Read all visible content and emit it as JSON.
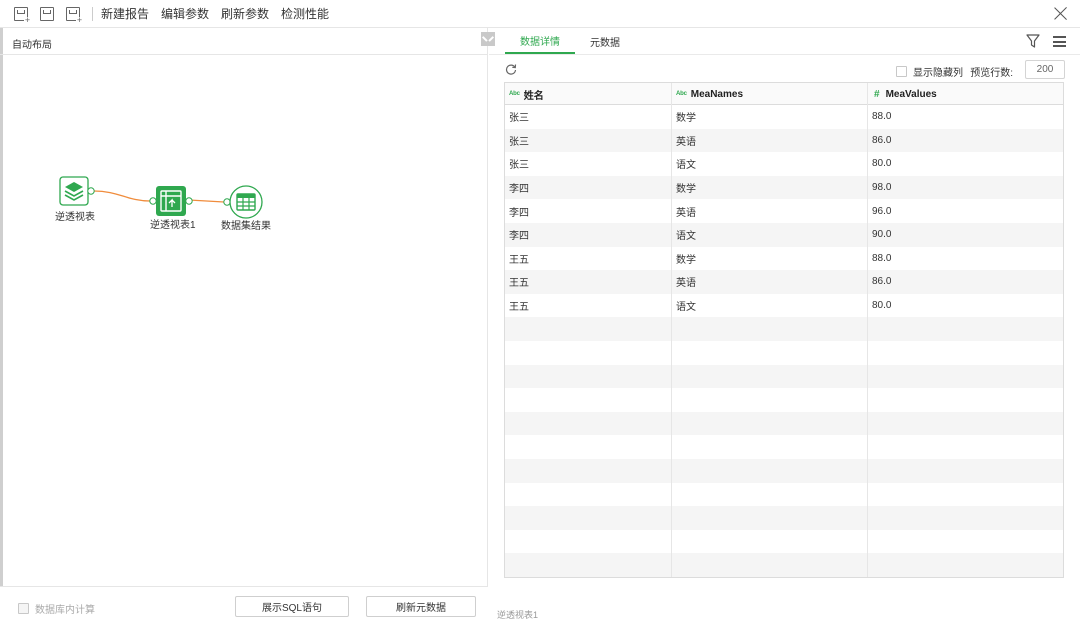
{
  "toolbar": {
    "new_report": "新建报告",
    "edit_params": "编辑参数",
    "refresh_params": "刷新参数",
    "check_performance": "检测性能"
  },
  "left": {
    "auto_layout": "自动布局",
    "nodes": [
      {
        "label": "逆透视表",
        "icon": "layers-icon"
      },
      {
        "label": "逆透视表1",
        "icon": "unpivot-icon"
      },
      {
        "label": "数据集结果",
        "icon": "table-icon"
      }
    ],
    "footer": {
      "db_compute_label": "数据库内计算",
      "show_sql": "展示SQL语句",
      "refresh_meta": "刷新元数据"
    }
  },
  "right": {
    "tabs": [
      {
        "label": "数据详情",
        "active": true
      },
      {
        "label": "元数据",
        "active": false
      }
    ],
    "show_hidden_label": "显示隐藏列",
    "preview_label": "预览行数:",
    "preview_rows": "200",
    "columns": [
      {
        "type": "Abc",
        "label": "姓名"
      },
      {
        "type": "Abc",
        "label": "MeaNames"
      },
      {
        "type": "#",
        "label": "MeaValues"
      }
    ],
    "rows": [
      [
        "张三",
        "数学",
        "88.0"
      ],
      [
        "张三",
        "英语",
        "86.0"
      ],
      [
        "张三",
        "语文",
        "80.0"
      ],
      [
        "李四",
        "数学",
        "98.0"
      ],
      [
        "李四",
        "英语",
        "96.0"
      ],
      [
        "李四",
        "语文",
        "90.0"
      ],
      [
        "王五",
        "数学",
        "88.0"
      ],
      [
        "王五",
        "英语",
        "86.0"
      ],
      [
        "王五",
        "语文",
        "80.0"
      ]
    ],
    "status": "逆透视表1"
  },
  "colors": {
    "accent": "#2fa84f",
    "connector": "#f08c3c"
  }
}
